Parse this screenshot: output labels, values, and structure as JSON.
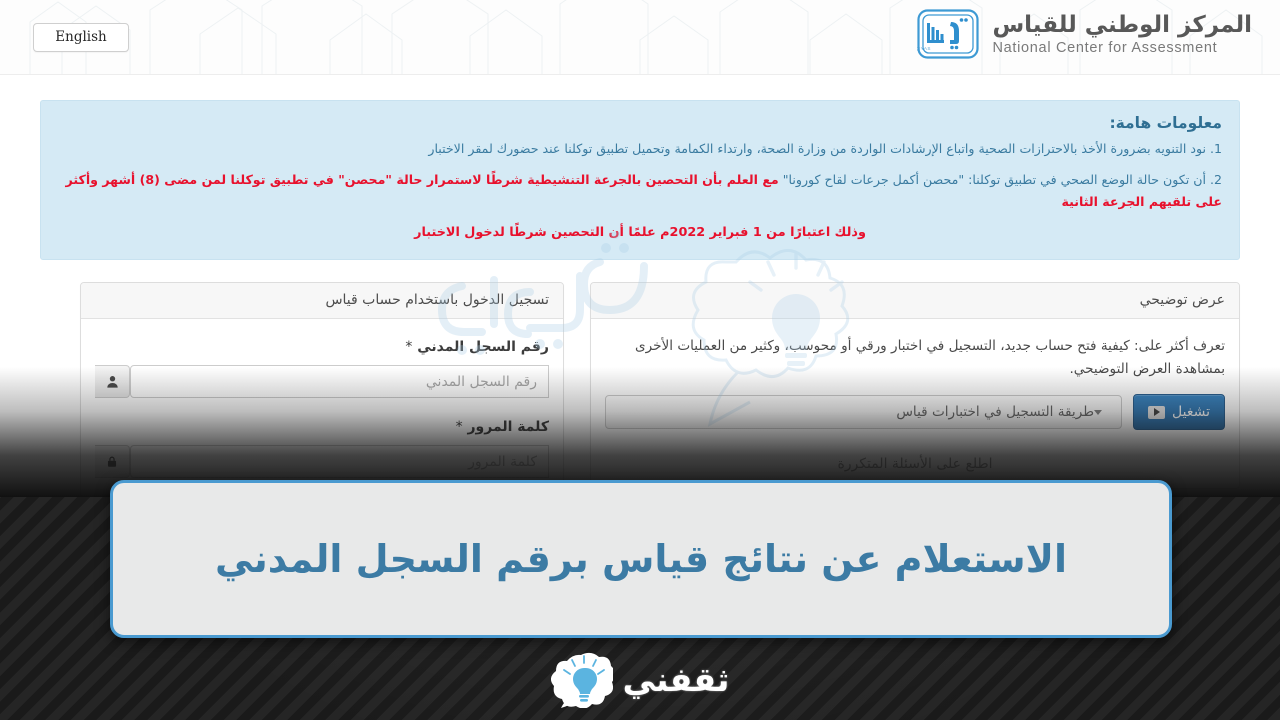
{
  "header": {
    "english_button": "English",
    "brand_ar": "المركز الوطني للقياس",
    "brand_en": "National Center for Assessment",
    "logo_mark": "qiyas-logo",
    "logo_caption": "QIYAS"
  },
  "alert": {
    "title": "معلومات هامة:",
    "line1": "1. نود التنويه بضرورة الأخذ بالاحترازات الصحية واتباع الإرشادات الواردة من وزارة الصحة، وارتداء الكمامة وتحميل تطبيق توكلنا عند حضورك لمقر الاختبار",
    "line2_black": "2. أن تكون حالة الوضع الصحي في تطبيق توكلنا: \"محصن أكمل جرعات لقاح كورونا\" ",
    "line2_red_a": "مع العلم بأن التحصين بالجرعة التنشيطية شرطًا لاستمرار حالة \"محصن\" في تطبيق توكلنا لمن مضى (8) أشهر وأكثر على تلقيهم الجرعة الثانية",
    "line3_red": "وذلك اعتبارًا من 1 فبراير 2022م علمًا أن التحصين شرطًا لدخول الاختبار"
  },
  "login_panel": {
    "heading": "تسجيل الدخول باستخدام حساب قياس",
    "id_label": "رقم السجل المدني",
    "id_required_mark": "*",
    "id_placeholder": "رقم السجل المدني",
    "id_value": "",
    "id_icon": "user-icon",
    "password_label": "كلمة المرور",
    "password_required_mark": "*",
    "password_placeholder": "كلمة المرور",
    "password_value": "",
    "password_icon": "lock-icon"
  },
  "demo_panel": {
    "heading": "عرض توضيحي",
    "description": "تعرف أكثر على: كيفية فتح حساب جديد، التسجيل في اختبار ورقي أو محوسب، وكثير من العمليات الأخرى بمشاهدة العرض التوضيحي.",
    "select_value": "طريقة التسجيل في اختبارات قياس",
    "select_icon": "chevron-down-icon",
    "play_button": "تشغيل",
    "play_icon": "play-icon",
    "faq_link": "اطلع على الأسئلة المتكررة"
  },
  "overlay_banner": {
    "headline": "الاستعلام عن نتائج قياس برقم السجل المدني",
    "border_color": "#4a9ad0",
    "text_color": "#3c7ba4",
    "background_color": "#e8e9e9"
  },
  "footer": {
    "wordmark": "ثقفني",
    "logo_icon": "lightbulb-speech-bubble-icon"
  },
  "theme": {
    "alert_background": "#d5eaf5",
    "alert_text": "#3a7ba0",
    "alert_emphasis": "#e8112d",
    "primary_button": "#2d6ca2",
    "page_background": "#ffffff",
    "backdrop": "#212121"
  }
}
